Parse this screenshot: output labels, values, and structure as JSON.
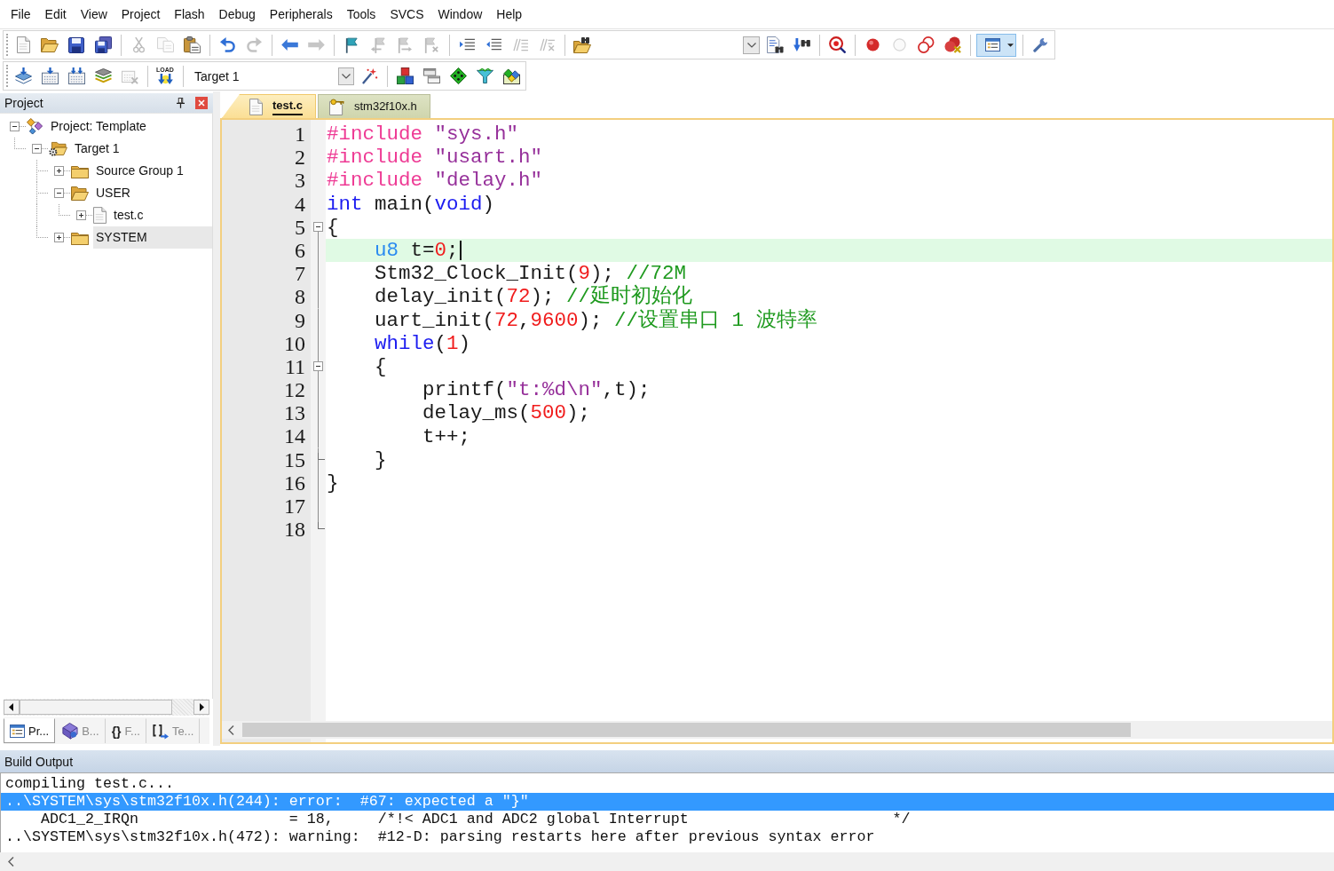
{
  "menu": [
    "File",
    "Edit",
    "View",
    "Project",
    "Flash",
    "Debug",
    "Peripherals",
    "Tools",
    "SVCS",
    "Window",
    "Help"
  ],
  "toolbars": [
    {
      "groups": [
        [
          {
            "kind": "button",
            "disabled": false,
            "pressed": false
          },
          {
            "kind": "button",
            "disabled": false,
            "pressed": false
          },
          {
            "kind": "button",
            "disabled": false,
            "pressed": false
          },
          {
            "kind": "button",
            "disabled": false,
            "pressed": false
          }
        ],
        [
          {
            "kind": "button",
            "disabled": true,
            "pressed": false
          },
          {
            "kind": "button",
            "disabled": true,
            "pressed": false
          },
          {
            "kind": "button",
            "disabled": false,
            "pressed": false
          }
        ],
        [
          {
            "kind": "button",
            "disabled": false,
            "pressed": false
          },
          {
            "kind": "button",
            "disabled": true,
            "pressed": false
          }
        ],
        [
          {
            "kind": "button",
            "disabled": false,
            "pressed": false
          },
          {
            "kind": "button",
            "disabled": true,
            "pressed": false
          }
        ],
        [
          {
            "kind": "button",
            "disabled": false,
            "pressed": false
          },
          {
            "kind": "button",
            "disabled": true,
            "pressed": false
          },
          {
            "kind": "button",
            "disabled": true,
            "pressed": false
          },
          {
            "kind": "button",
            "disabled": true,
            "pressed": false
          }
        ],
        [
          {
            "kind": "button",
            "disabled": false,
            "pressed": false
          },
          {
            "kind": "button",
            "disabled": false,
            "pressed": false
          },
          {
            "kind": "button",
            "disabled": true,
            "pressed": false
          },
          {
            "kind": "button",
            "disabled": true,
            "pressed": false
          }
        ],
        [
          {
            "kind": "button",
            "disabled": false,
            "pressed": false
          },
          {
            "kind": "combo",
            "disabled": false,
            "pressed": false
          },
          {
            "kind": "button",
            "disabled": false,
            "pressed": false
          },
          {
            "kind": "button",
            "disabled": false,
            "pressed": false
          }
        ],
        [
          {
            "kind": "button",
            "disabled": false,
            "pressed": false
          }
        ],
        [
          {
            "kind": "button",
            "disabled": false,
            "pressed": false
          },
          {
            "kind": "button",
            "disabled": true,
            "pressed": false
          },
          {
            "kind": "button",
            "disabled": false,
            "pressed": false
          },
          {
            "kind": "button",
            "disabled": false,
            "pressed": false
          }
        ],
        [
          {
            "kind": "dropdown",
            "disabled": false,
            "pressed": true
          }
        ],
        [
          {
            "kind": "button",
            "disabled": false,
            "pressed": false
          }
        ]
      ]
    },
    {
      "groups": [
        [
          {
            "kind": "button",
            "disabled": false,
            "pressed": false
          },
          {
            "kind": "button",
            "disabled": false,
            "pressed": false
          },
          {
            "kind": "button",
            "disabled": false,
            "pressed": false
          },
          {
            "kind": "button",
            "disabled": false,
            "pressed": false
          },
          {
            "kind": "button",
            "disabled": true,
            "pressed": false
          }
        ],
        [
          {
            "kind": "button",
            "label": "LOAD",
            "disabled": false,
            "pressed": false
          }
        ],
        [
          {
            "kind": "select",
            "value": "Target 1",
            "disabled": false,
            "pressed": false
          },
          {
            "kind": "button",
            "disabled": false,
            "pressed": false
          }
        ],
        [
          {
            "kind": "button",
            "disabled": false,
            "pressed": false
          },
          {
            "kind": "button",
            "disabled": false,
            "pressed": false
          },
          {
            "kind": "button",
            "disabled": false,
            "pressed": false
          },
          {
            "kind": "button",
            "disabled": false,
            "pressed": false
          },
          {
            "kind": "button",
            "disabled": false,
            "pressed": false
          }
        ]
      ]
    }
  ],
  "project_panel": {
    "title": "Project",
    "tree": [
      {
        "label": "Project: Template",
        "kind": "project",
        "expanded": true,
        "selected": false,
        "children": [
          {
            "label": "Target 1",
            "kind": "target",
            "expanded": true,
            "selected": false,
            "children": [
              {
                "label": "Source Group 1",
                "kind": "group",
                "expanded": false,
                "selected": false
              },
              {
                "label": "USER",
                "kind": "group",
                "expanded": true,
                "selected": false,
                "children": [
                  {
                    "label": "test.c",
                    "kind": "file",
                    "expanded": false,
                    "selected": false
                  }
                ]
              },
              {
                "label": "SYSTEM",
                "kind": "group",
                "expanded": false,
                "selected": true
              }
            ]
          }
        ]
      }
    ],
    "tabs": [
      {
        "label": "Pr...",
        "selected": true
      },
      {
        "label": "B...",
        "selected": false
      },
      {
        "glyph": "{}",
        "label": "F...",
        "selected": false
      },
      {
        "label": "Te...",
        "selected": false
      }
    ]
  },
  "editor": {
    "tabs": [
      {
        "label": "test.c",
        "selected": true
      },
      {
        "label": "stm32f10x.h",
        "selected": false
      }
    ],
    "lines": [
      {
        "number": "1",
        "collapsible": false,
        "block_end": false,
        "current": false,
        "tokens": [
          {
            "text": "#include",
            "kind": "directive"
          },
          {
            "text": " \"sys.h\"",
            "kind": "string"
          }
        ]
      },
      {
        "number": "2",
        "collapsible": false,
        "block_end": false,
        "current": false,
        "tokens": [
          {
            "text": "#include",
            "kind": "directive"
          },
          {
            "text": " \"usart.h\"",
            "kind": "string"
          }
        ]
      },
      {
        "number": "3",
        "collapsible": false,
        "block_end": false,
        "current": false,
        "tokens": [
          {
            "text": "#include",
            "kind": "directive"
          },
          {
            "text": " \"delay.h\"",
            "kind": "string"
          }
        ]
      },
      {
        "number": "4",
        "collapsible": false,
        "block_end": false,
        "current": false,
        "tokens": [
          {
            "text": "int",
            "kind": "keyword"
          },
          {
            "text": " main(",
            "kind": "text"
          },
          {
            "text": "void",
            "kind": "keyword"
          },
          {
            "text": ")",
            "kind": "text"
          }
        ]
      },
      {
        "number": "5",
        "collapsible": true,
        "block_end": false,
        "current": false,
        "tokens": [
          {
            "text": "{",
            "kind": "text"
          }
        ]
      },
      {
        "number": "6",
        "collapsible": false,
        "block_end": false,
        "current": true,
        "tokens": [
          {
            "text": "    u8",
            "kind": "type"
          },
          {
            "text": " t=",
            "kind": "text"
          },
          {
            "text": "0",
            "kind": "number"
          },
          {
            "text": ";",
            "kind": "text"
          }
        ]
      },
      {
        "number": "7",
        "collapsible": false,
        "block_end": false,
        "current": false,
        "tokens": [
          {
            "text": "    Stm32_Clock_Init(",
            "kind": "text"
          },
          {
            "text": "9",
            "kind": "number"
          },
          {
            "text": "); ",
            "kind": "text"
          },
          {
            "text": "//72M",
            "kind": "comment"
          }
        ]
      },
      {
        "number": "8",
        "collapsible": false,
        "block_end": false,
        "current": false,
        "tokens": [
          {
            "text": "    delay_init(",
            "kind": "text"
          },
          {
            "text": "72",
            "kind": "number"
          },
          {
            "text": "); ",
            "kind": "text"
          },
          {
            "text": "//延时初始化",
            "kind": "comment"
          }
        ]
      },
      {
        "number": "9",
        "collapsible": false,
        "block_end": false,
        "current": false,
        "tokens": [
          {
            "text": "    uart_init(",
            "kind": "text"
          },
          {
            "text": "72",
            "kind": "number"
          },
          {
            "text": ",",
            "kind": "text"
          },
          {
            "text": "9600",
            "kind": "number"
          },
          {
            "text": "); ",
            "kind": "text"
          },
          {
            "text": "//设置串口 1 波特率",
            "kind": "comment"
          }
        ]
      },
      {
        "number": "10",
        "collapsible": false,
        "block_end": false,
        "current": false,
        "tokens": [
          {
            "text": "    while",
            "kind": "keyword"
          },
          {
            "text": "(",
            "kind": "text"
          },
          {
            "text": "1",
            "kind": "number"
          },
          {
            "text": ")",
            "kind": "text"
          }
        ]
      },
      {
        "number": "11",
        "collapsible": true,
        "block_end": false,
        "current": false,
        "tokens": [
          {
            "text": "    {",
            "kind": "text"
          }
        ]
      },
      {
        "number": "12",
        "collapsible": false,
        "block_end": false,
        "current": false,
        "tokens": [
          {
            "text": "        printf(",
            "kind": "text"
          },
          {
            "text": "\"t:%d\\n\"",
            "kind": "string"
          },
          {
            "text": ",t);",
            "kind": "text"
          }
        ]
      },
      {
        "number": "13",
        "collapsible": false,
        "block_end": false,
        "current": false,
        "tokens": [
          {
            "text": "        delay_ms(",
            "kind": "text"
          },
          {
            "text": "500",
            "kind": "number"
          },
          {
            "text": ");",
            "kind": "text"
          }
        ]
      },
      {
        "number": "14",
        "collapsible": false,
        "block_end": false,
        "current": false,
        "tokens": [
          {
            "text": "        t++;",
            "kind": "text"
          }
        ]
      },
      {
        "number": "15",
        "collapsible": false,
        "block_end": true,
        "current": false,
        "tokens": [
          {
            "text": "    }",
            "kind": "text"
          }
        ]
      },
      {
        "number": "16",
        "collapsible": false,
        "block_end": false,
        "current": false,
        "tokens": [
          {
            "text": "}",
            "kind": "text"
          }
        ]
      },
      {
        "number": "17",
        "collapsible": false,
        "block_end": false,
        "current": false
      },
      {
        "number": "18",
        "collapsible": false,
        "block_end": true,
        "current": false
      }
    ]
  },
  "build_output": {
    "title": "Build Output",
    "lines": [
      {
        "text": "compiling test.c...",
        "selected": false
      },
      {
        "text": "..\\SYSTEM\\sys\\stm32f10x.h(244): error:  #67: expected a \"}\"",
        "selected": true
      },
      {
        "text": "    ADC1_2_IRQn                 = 18,     /*!< ADC1 and ADC2 global Interrupt                       */",
        "selected": false
      },
      {
        "text": "..\\SYSTEM\\sys\\stm32f10x.h(472): warning:  #12-D: parsing restarts here after previous syntax error",
        "selected": false
      }
    ]
  }
}
